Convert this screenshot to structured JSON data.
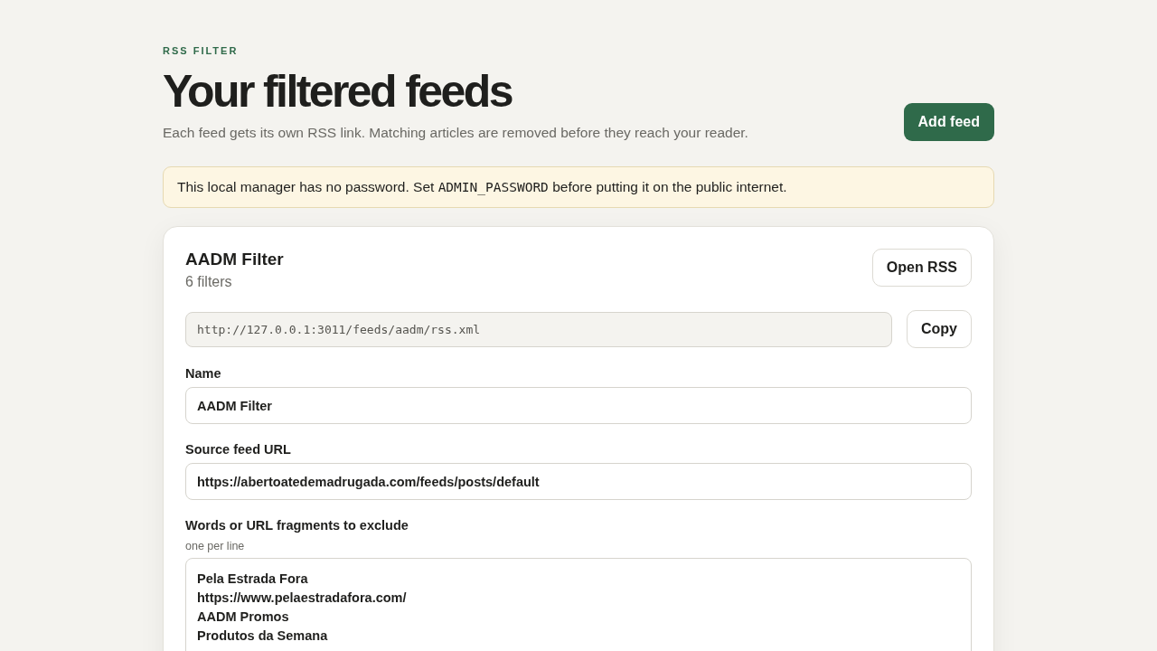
{
  "eyebrow": "RSS FILTER",
  "title": "Your filtered feeds",
  "subtitle": "Each feed gets its own RSS link. Matching articles are removed before they reach your reader.",
  "add_button": "Add feed",
  "notice": {
    "before": "This local manager has no password. Set ",
    "code": "ADMIN_PASSWORD",
    "after": " before putting it on the public internet."
  },
  "feed": {
    "name": "AADM Filter",
    "count": "6 filters",
    "open_button": "Open RSS",
    "rss_url": "http://127.0.0.1:3011/feeds/aadm/rss.xml",
    "copy_button": "Copy",
    "fields": [
      {
        "kind": "input",
        "label": "Name",
        "value": "AADM Filter"
      },
      {
        "kind": "input",
        "label": "Source feed URL",
        "value": "https://abertoatedemadrugada.com/feeds/posts/default"
      },
      {
        "kind": "textarea",
        "label": "Words or URL fragments to exclude",
        "hint": "one per line",
        "lines": [
          "Pela Estrada Fora",
          "https://www.pelaestradafora.com/",
          "AADM Promos",
          "Produtos da Semana"
        ]
      }
    ]
  }
}
